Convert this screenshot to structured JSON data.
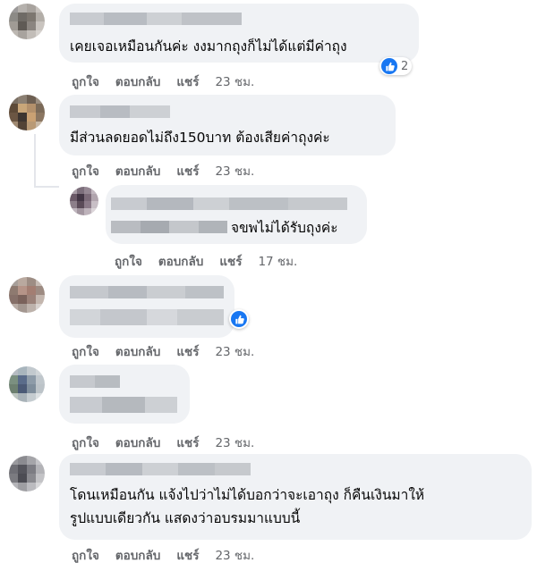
{
  "comments": [
    {
      "text": "เคยเจอเหมือนกันค่ะ งงมากถุงก็ไม่ได้แต่มีค่าถุง",
      "like": "ถูกใจ",
      "reply": "ตอบกลับ",
      "share": "แชร์",
      "time": "23 ชม.",
      "reaction_count": "2"
    },
    {
      "text": "มีส่วนลดยอดไม่ถึง150บาท ต้องเสียค่าถุงค่ะ",
      "like": "ถูกใจ",
      "reply": "ตอบกลับ",
      "share": "แชร์",
      "time": "23 ชม."
    },
    {
      "text": "จขพไม่ได้รับถุงค่ะ",
      "like": "ถูกใจ",
      "reply": "ตอบกลับ",
      "share": "แชร์",
      "time": "17 ชม."
    },
    {
      "text": "",
      "like": "ถูกใจ",
      "reply": "ตอบกลับ",
      "share": "แชร์",
      "time": "23 ชม."
    },
    {
      "text": "",
      "like": "ถูกใจ",
      "reply": "ตอบกลับ",
      "share": "แชร์",
      "time": "23 ชม."
    },
    {
      "text_line1": "โดนเหมือนกัน แจ้งไปว่าไม่ได้บอกว่าจะเอาถุง ก็คืนเงินมาให้",
      "text_line2": "รูปแบบเดียวกัน แสดงว่าอบรมมาแบบนี้",
      "like": "ถูกใจ",
      "reply": "ตอบกลับ",
      "share": "แชร์",
      "time": "23 ชม."
    }
  ],
  "colors": {
    "bubble": "#f0f2f5",
    "like_blue": "#1877f2",
    "meta_gray": "#65676b"
  },
  "icons": {
    "reaction": "like-icon"
  }
}
